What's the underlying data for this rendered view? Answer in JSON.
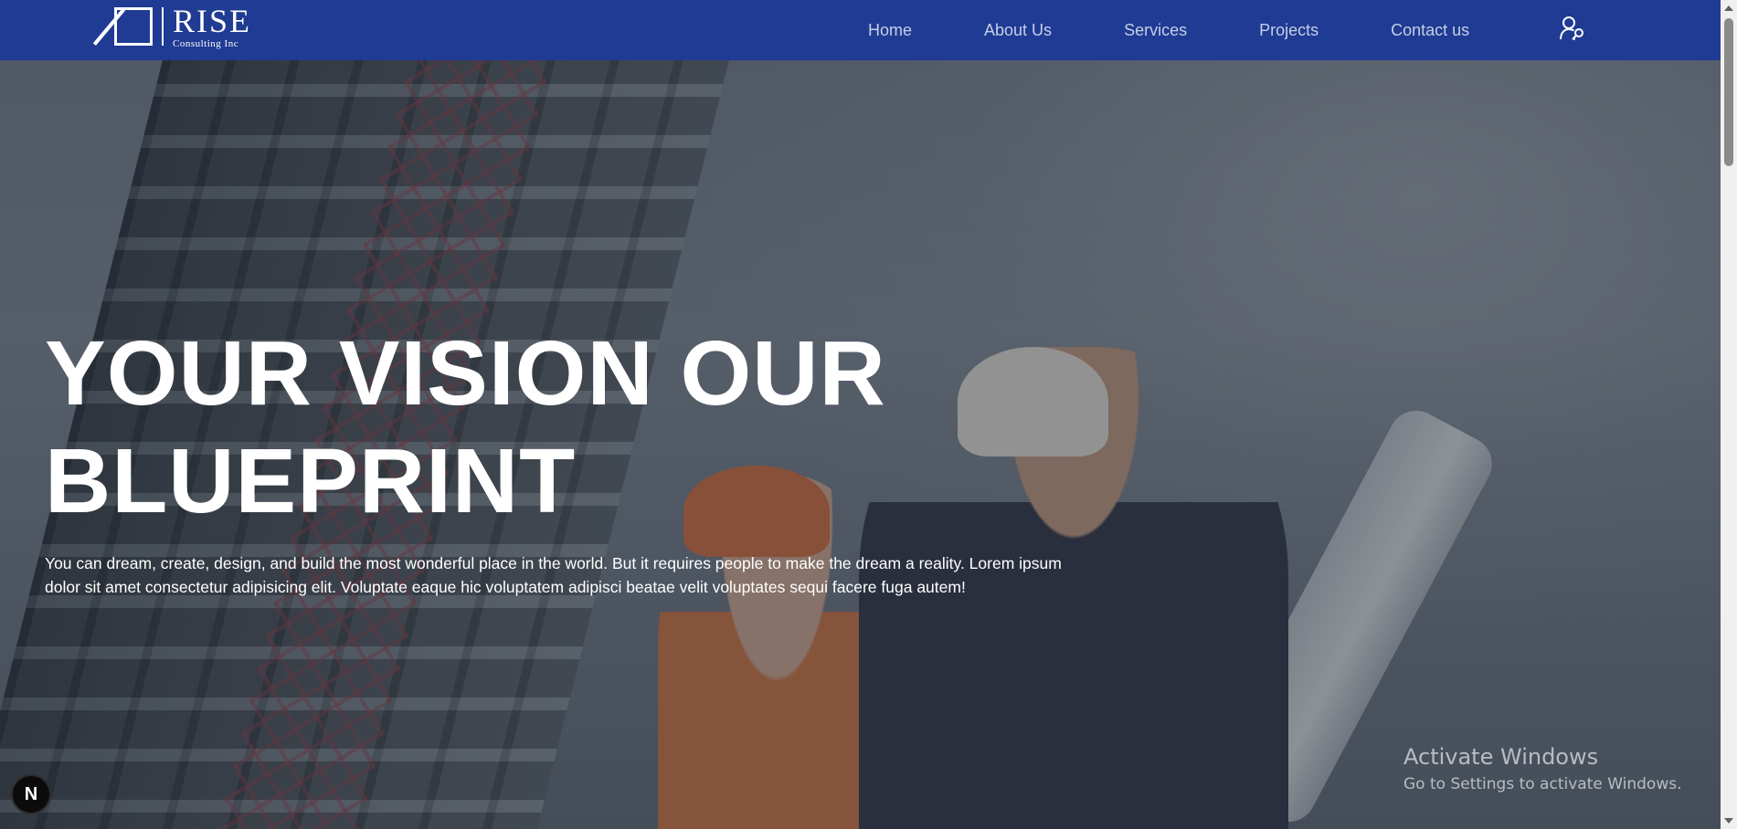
{
  "brand": {
    "name": "RISE",
    "subtitle": "Consulting Inc",
    "nav_color": "#1f3b93"
  },
  "nav": {
    "links": [
      {
        "label": "Home"
      },
      {
        "label": "About Us"
      },
      {
        "label": "Services"
      },
      {
        "label": "Projects"
      },
      {
        "label": "Contact us"
      }
    ],
    "user_icon": "user-key-icon"
  },
  "hero": {
    "title": "YOUR VISION OUR BLUEPRINT",
    "description": "You can dream, create, design, and build the most wonderful place in the world. But it requires people to make the dream a reality. Lorem ipsum dolor sit amet consectetur adipisicing elit. Voluptate eaque hic voluptatem adipisci beatae velit voluptates sequi facere fuga autem!"
  },
  "watermark": {
    "title": "Activate Windows",
    "subtitle": "Go to Settings to activate Windows."
  },
  "badge": {
    "letter": "N"
  }
}
